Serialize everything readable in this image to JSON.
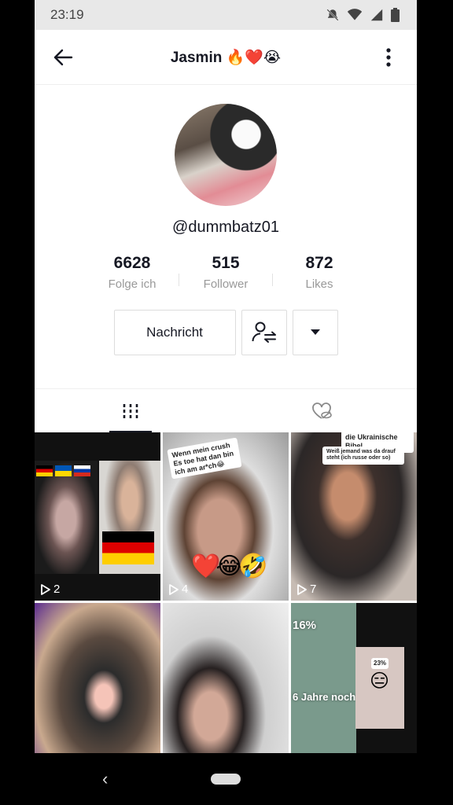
{
  "status_bar": {
    "time": "23:19"
  },
  "header": {
    "title": "Jasmin 🔥❤️😭"
  },
  "profile": {
    "handle": "@dummbatz01"
  },
  "stats": [
    {
      "value": "6628",
      "label": "Folge ich"
    },
    {
      "value": "515",
      "label": "Follower"
    },
    {
      "value": "872",
      "label": "Likes"
    }
  ],
  "actions": {
    "message_label": "Nachricht"
  },
  "tabs": [
    {
      "icon": "videos-grid-icon",
      "active": true
    },
    {
      "icon": "liked-hidden-icon",
      "active": false
    }
  ],
  "videos": [
    {
      "views": "2",
      "flags": [
        "de",
        "ua",
        "ru"
      ]
    },
    {
      "views": "4",
      "caption": "Wenn mein crush Es toe hat dan bin ich am ar*ch😂",
      "emojis": "❤️😂🤣"
    },
    {
      "views": "7",
      "caption_top": "die Ukrainische Bibel",
      "caption": "Weiß jemand was da drauf steht (ich russe oder so)"
    },
    {},
    {},
    {
      "overlay_percent": "16%",
      "overlay_text": "6 Jahre noch",
      "sub_percent": "23%",
      "sub_emoji": "😑"
    }
  ],
  "colors": {
    "text_primary": "#161823",
    "text_secondary": "#999999",
    "status_bar_bg": "#e8e8e8"
  }
}
